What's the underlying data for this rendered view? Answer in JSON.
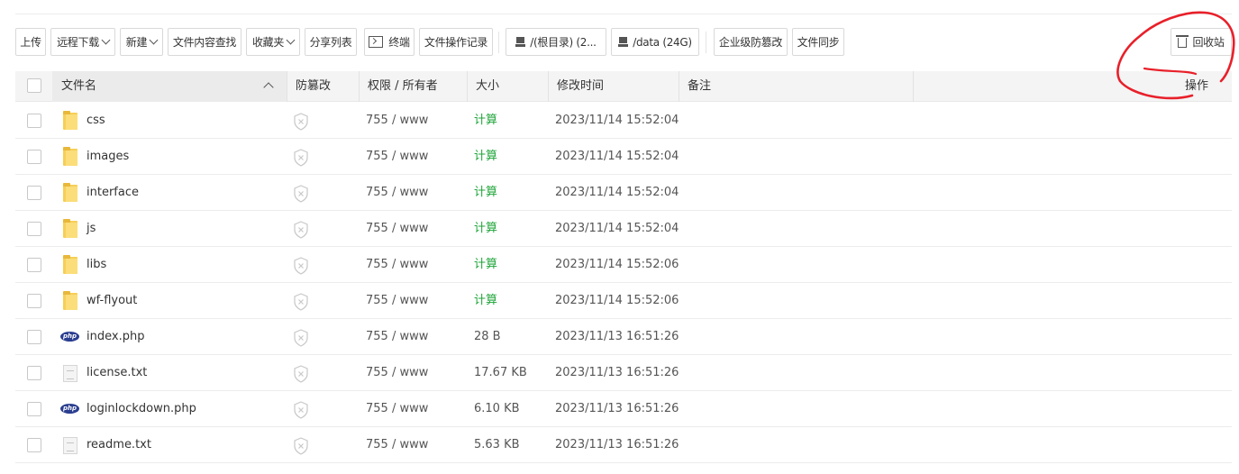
{
  "toolbar": {
    "upload": "上传",
    "remote_download": "远程下载",
    "new": "新建",
    "content_search": "文件内容查找",
    "favorites": "收藏夹",
    "share_list": "分享列表",
    "terminal": "终端",
    "file_op_log": "文件操作记录",
    "disk_root": "/(根目录) (2...",
    "disk_data": "/data (24G)",
    "enterprise_tamper": "企业级防篡改",
    "file_sync": "文件同步",
    "recycle_bin": "回收站"
  },
  "table": {
    "headers": {
      "name": "文件名",
      "tamper": "防篡改",
      "perm_owner": "权限 / 所有者",
      "size": "大小",
      "mtime": "修改时间",
      "remark": "备注",
      "ops": "操作"
    },
    "rows": [
      {
        "type": "folder",
        "name": "css",
        "perm": "755 / www",
        "size": "计算",
        "mtime": "2023/11/14 15:52:04"
      },
      {
        "type": "folder",
        "name": "images",
        "perm": "755 / www",
        "size": "计算",
        "mtime": "2023/11/14 15:52:04"
      },
      {
        "type": "folder",
        "name": "interface",
        "perm": "755 / www",
        "size": "计算",
        "mtime": "2023/11/14 15:52:04"
      },
      {
        "type": "folder",
        "name": "js",
        "perm": "755 / www",
        "size": "计算",
        "mtime": "2023/11/14 15:52:04"
      },
      {
        "type": "folder",
        "name": "libs",
        "perm": "755 / www",
        "size": "计算",
        "mtime": "2023/11/14 15:52:06"
      },
      {
        "type": "folder",
        "name": "wf-flyout",
        "perm": "755 / www",
        "size": "计算",
        "mtime": "2023/11/14 15:52:06"
      },
      {
        "type": "php",
        "name": "index.php",
        "perm": "755 / www",
        "size": "28 B",
        "mtime": "2023/11/13 16:51:26"
      },
      {
        "type": "text",
        "name": "license.txt",
        "perm": "755 / www",
        "size": "17.67 KB",
        "mtime": "2023/11/13 16:51:26"
      },
      {
        "type": "php",
        "name": "loginlockdown.php",
        "perm": "755 / www",
        "size": "6.10 KB",
        "mtime": "2023/11/13 16:51:26"
      },
      {
        "type": "text",
        "name": "readme.txt",
        "perm": "755 / www",
        "size": "5.63 KB",
        "mtime": "2023/11/13 16:51:26"
      }
    ]
  },
  "icons": {
    "folder": "folder-icon",
    "php": "php-file-icon",
    "text": "text-file-icon",
    "tamper": "tamper-shield-icon",
    "php_label": "php"
  },
  "colors": {
    "calc_green": "#20a53a",
    "annotation_red": "#e8202a",
    "folder_yellow": "#f6cf57"
  }
}
